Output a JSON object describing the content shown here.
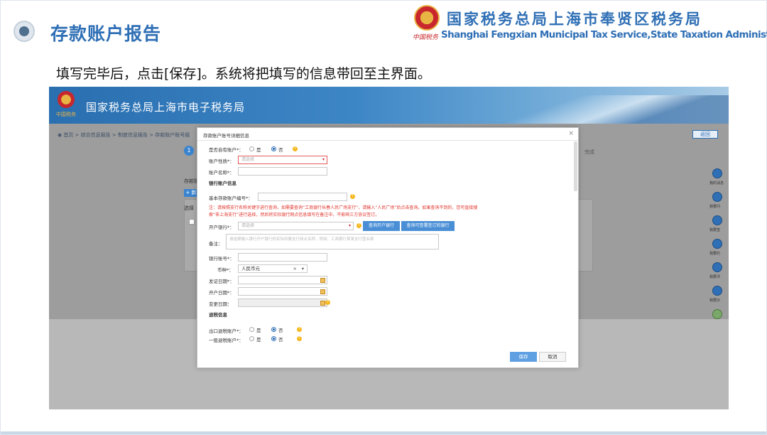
{
  "slide": {
    "title": "存款账户报告",
    "org_cn": "国家税务总局上海市奉贤区税务局",
    "org_en": "Shanghai Fengxian Municipal Tax Service,State Taxation  Administration",
    "emblem_script": "中国税务",
    "instruction": "填写完毕后，点击[保存]。系统将把填写的信息带回至主界面。"
  },
  "app": {
    "banner_title": "国家税务总局上海市电子税务局",
    "logo_text": "中国税务",
    "breadcrumb": "◉ 首页  >  综合信息报告  >  制度信息报告  >  存款账户账号报",
    "back_label": "返回",
    "step_number": "1",
    "step_done": "完成",
    "left_label": "存款账",
    "add_label": "+ 新",
    "select_label": "选择",
    "side_icons": [
      {
        "name": "message-icon",
        "label": "我的消息"
      },
      {
        "name": "question-icon",
        "label": "我要问"
      },
      {
        "name": "search-icon",
        "label": "我要查"
      },
      {
        "name": "appointment-icon",
        "label": "我要约"
      },
      {
        "name": "evaluate-icon",
        "label": "我要评"
      },
      {
        "name": "edit-icon",
        "label": "我要办"
      },
      {
        "name": "robot-icon",
        "label": ""
      }
    ]
  },
  "modal": {
    "title": "存款账户账号详细信息",
    "close": "×",
    "is_self_account_label": "是否自有账户*：",
    "yes": "是",
    "no": "否",
    "account_nature_label": "账户性质*：",
    "account_nature_placeholder": "请选择",
    "account_name_label": "账户名称*：",
    "section_bank": "银行账户信息",
    "basic_account_no_label": "基本存款账户编号*：",
    "note": "注：请按照支行名称关键字进行查询，如需要查询“工商银行长春人民广场支行”，请输入“人民广场”后点击查询。如果查询不到的，您可直接搜索“非上海支行”进行选择，然后将实际银行网点信息填写在备注中，不影响三方协议签订。",
    "open_bank_label": "开户银行*：",
    "open_bank_placeholder": "请选择",
    "btn_query_bank": "查询开户银行",
    "btn_query_signed": "查询可签署签订的银行",
    "remark_label": "备注：",
    "remark_placeholder": "请选择输入银行开户银行的实际所属支行网点名称，例如：工商银行某某支行营业部",
    "bank_account_no_label": "银行账号*：",
    "currency_label": "币种*：",
    "currency_value": "人民币元",
    "issue_date_label": "发证日期*：",
    "open_date_label": "开户日期*：",
    "change_date_label": "变更日期：",
    "section_refund": "退税信息",
    "export_refund_label": "出口退税账户*：",
    "general_refund_label": "一般退税账户*：",
    "save": "保存",
    "cancel": "取消"
  }
}
